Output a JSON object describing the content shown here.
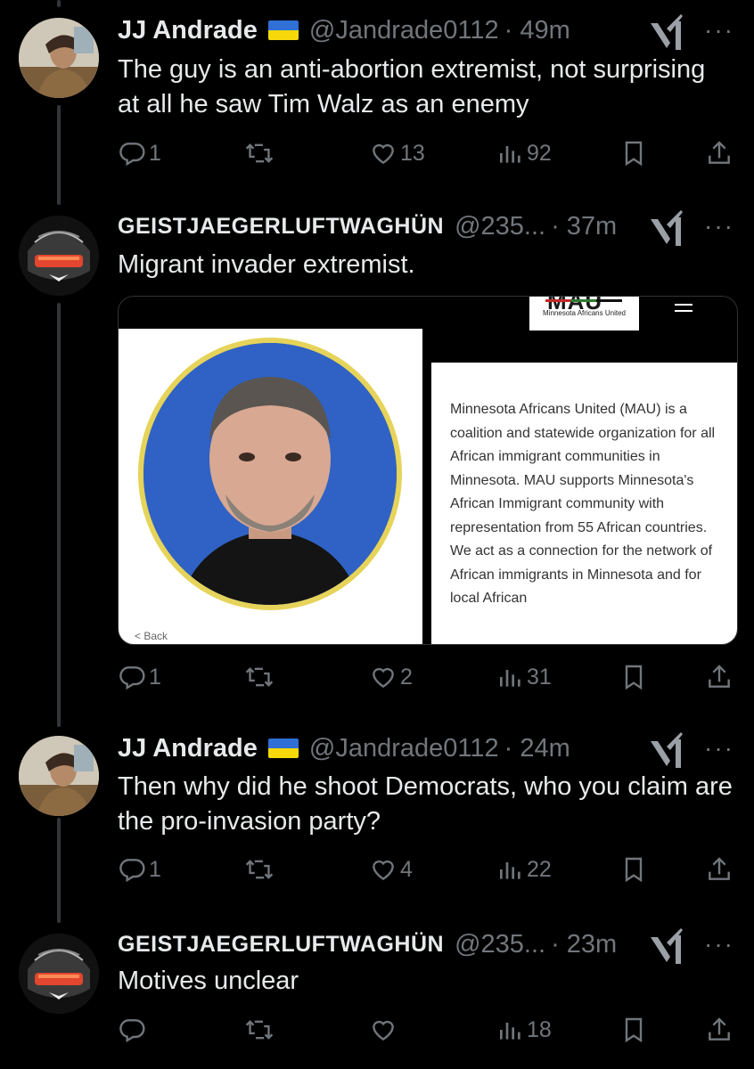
{
  "tweets": [
    {
      "name": "JJ Andrade",
      "flag": "ukraine-flag",
      "handle": "@Jandrade0112",
      "time": "· 49m",
      "text": "The guy is an anti-abortion extremist, not surprising at all he saw Tim Walz as an enemy",
      "replies": "1",
      "retweets": "",
      "likes": "13",
      "views": "92"
    },
    {
      "name": "GEISTJAEGERLUFTWAGHÜN",
      "handle": "@235...",
      "time": "· 37m",
      "text": "Migrant invader extremist.",
      "replies": "1",
      "retweets": "",
      "likes": "2",
      "views": "31",
      "media": {
        "logo_title": "MAU",
        "logo_subtitle": "Minnesota Africans United",
        "card_text": "Minnesota Africans United (MAU) is a coalition and statewide organization for all African immigrant communities in Minnesota. MAU supports Minnesota's African Immigrant community with representation from 55 African countries. We act as a connection for the network of African immigrants in Minnesota and for local African",
        "back_label": "< Back"
      }
    },
    {
      "name": "JJ Andrade",
      "flag": "ukraine-flag",
      "handle": "@Jandrade0112",
      "time": "· 24m",
      "text": "Then why did he shoot Democrats, who you claim are the pro-invasion party?",
      "replies": "1",
      "retweets": "",
      "likes": "4",
      "views": "22"
    },
    {
      "name": "GEISTJAEGERLUFTWAGHÜN",
      "handle": "@235...",
      "time": "· 23m",
      "text": "Motives unclear",
      "replies": "",
      "retweets": "",
      "likes": "",
      "views": "18"
    }
  ],
  "more_label": "···",
  "colors": {
    "text": "#e7e9ea",
    "muted": "#71767b",
    "thread_line": "#333639",
    "background": "#000000"
  }
}
